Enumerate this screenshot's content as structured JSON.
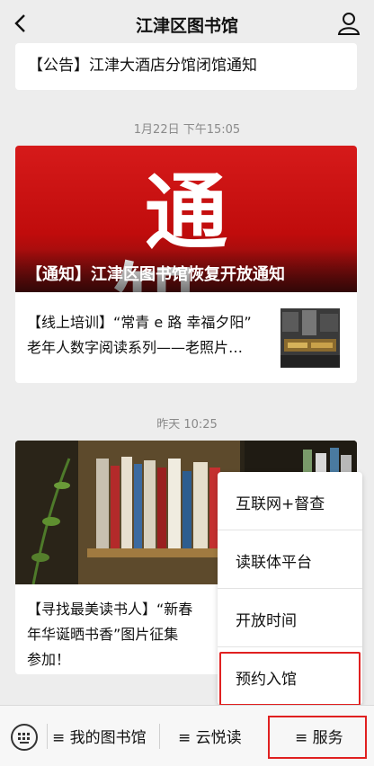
{
  "header": {
    "title": "江津区图书馆"
  },
  "messages": [
    {
      "text": "【公告】江津大酒店分馆闭馆通知"
    }
  ],
  "timestamps": [
    "1月22日 下午15:05",
    "昨天 10:25"
  ],
  "notice_card": {
    "banner_big_text": "通知",
    "banner_caption": "【通知】江津区图书馆恢复开放通知",
    "sub_line1": "【线上培训】“常青 e 路 幸福夕阳”",
    "sub_line2": "老年人数字阅读系列——老照片…"
  },
  "reader_card": {
    "line1": "【寻找最美读书人】“新春",
    "line2": "年华诞晒书香”图片征集",
    "line3": "参加！"
  },
  "popup_menu": {
    "items": [
      "互联网+督查",
      "读联体平台",
      "开放时间",
      "预约入馆"
    ]
  },
  "bottom_menu": {
    "tabs": [
      "≡ 我的图书馆",
      "≡ 云悦读",
      "≡ 服务"
    ]
  },
  "colors": {
    "highlight": "#e02020",
    "banner_red": "#c00c0c"
  }
}
